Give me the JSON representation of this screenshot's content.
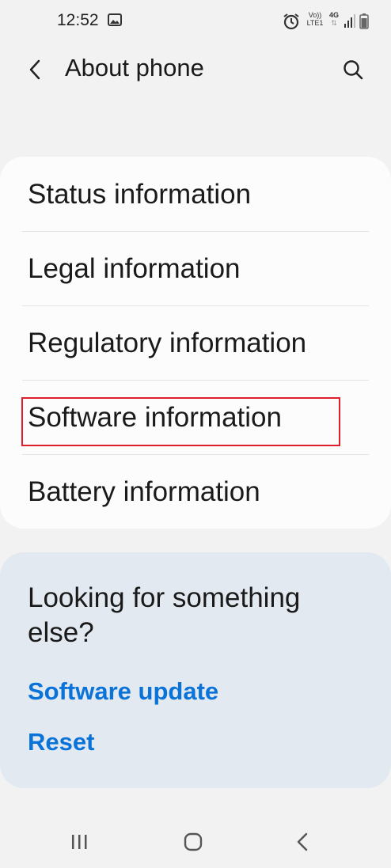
{
  "status_bar": {
    "time": "12:52",
    "icons": [
      "gallery-icon",
      "alarm-icon",
      "volte-icon",
      "4g-data-icon",
      "signal-icon",
      "battery-icon"
    ],
    "volte_top": "Vo))",
    "volte_bottom": "LTE1",
    "network": "4G"
  },
  "header": {
    "title": "About phone",
    "back_icon": "chevron-left-icon",
    "search_icon": "search-icon"
  },
  "info_list": {
    "items": [
      {
        "label": "Status information"
      },
      {
        "label": "Legal information"
      },
      {
        "label": "Regulatory information"
      },
      {
        "label": "Software information",
        "highlighted": true
      },
      {
        "label": "Battery information"
      }
    ],
    "highlight_color": "#e01f2c"
  },
  "suggestions": {
    "title": "Looking for something else?",
    "links": [
      {
        "label": "Software update"
      },
      {
        "label": "Reset"
      }
    ],
    "link_color": "#0a73d9"
  },
  "nav_bar": {
    "buttons": [
      "recent-apps-icon",
      "home-icon",
      "back-icon"
    ]
  }
}
